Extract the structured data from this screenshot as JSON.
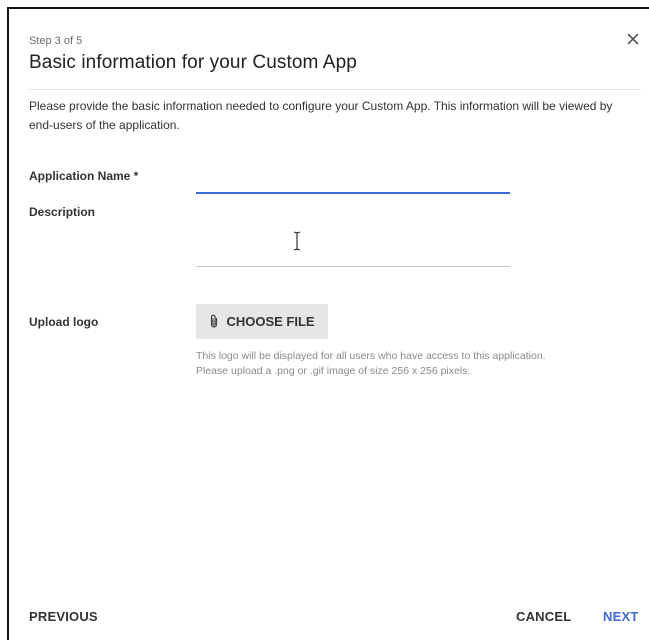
{
  "dialog": {
    "step_label": "Step 3 of 5",
    "title": "Basic information for your Custom App",
    "intro": "Please provide the basic information needed to configure your Custom App. This information will be viewed by end-users of the application.",
    "close_icon": "close-icon"
  },
  "form": {
    "app_name": {
      "label": "Application Name *",
      "value": ""
    },
    "description": {
      "label": "Description",
      "value": ""
    },
    "upload_logo": {
      "label": "Upload logo",
      "button_label": "CHOOSE FILE",
      "button_icon": "paperclip-icon",
      "help_line1": "This logo will be displayed for all users who have access to this application.",
      "help_line2": "Please upload a .png or .gif image of size 256 x 256 pixels."
    }
  },
  "footer": {
    "previous_label": "PREVIOUS",
    "cancel_label": "CANCEL",
    "next_label": "NEXT"
  },
  "colors": {
    "accent": "#3d6ad6",
    "next_button": "#3d6ad6",
    "button_bg": "#e6e6e6",
    "text_primary": "#333333",
    "help_text": "#8a8a8a"
  }
}
